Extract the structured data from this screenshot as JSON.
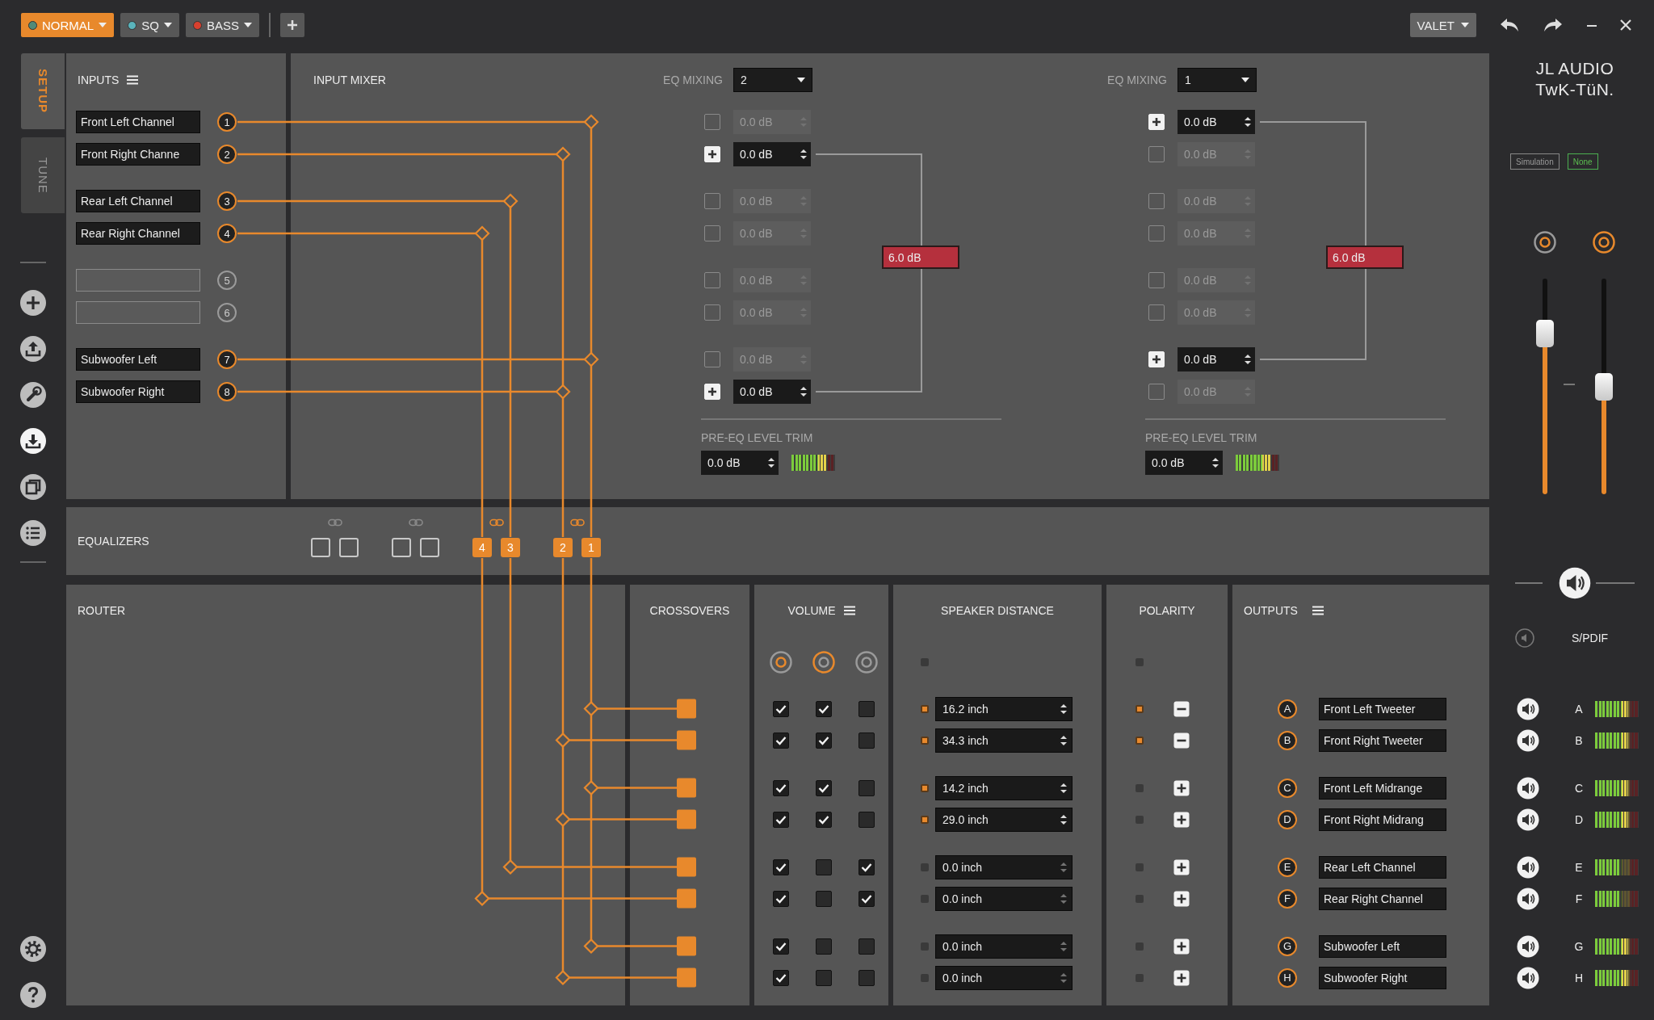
{
  "toolbar": {
    "presets": [
      {
        "label": "NORMAL",
        "selected": true,
        "color": "#4f8a78"
      },
      {
        "label": "SQ",
        "selected": false,
        "color": "#5ab4bc"
      },
      {
        "label": "BASS",
        "selected": false,
        "color": "#d8402e"
      }
    ],
    "mode_button": "VALET"
  },
  "side_tabs": [
    {
      "label": "SETUP",
      "selected": true
    },
    {
      "label": "TUNE",
      "selected": false
    }
  ],
  "inputs": {
    "title": "INPUTS",
    "items": [
      {
        "name": "Front Left Channel",
        "number": "1",
        "kind": "lane1"
      },
      {
        "name": "Front Right Channe",
        "number": "2",
        "kind": "lane2"
      },
      {
        "name": "Rear Left Channel",
        "number": "3",
        "kind": "lane3"
      },
      {
        "name": "Rear Right Channel",
        "number": "4",
        "kind": "lane4"
      },
      {
        "number": "5",
        "kind": "unrouted"
      },
      {
        "number": "6",
        "kind": "unrouted"
      },
      {
        "name": "Subwoofer Left",
        "number": "7",
        "kind": "lane1"
      },
      {
        "name": "Subwoofer Right",
        "number": "8",
        "kind": "lane2"
      }
    ]
  },
  "input_mixer": {
    "title": "INPUT MIXER",
    "groups": [
      {
        "label": "EQ MIXING",
        "value": "2",
        "rows": [
          {
            "checked": false,
            "value": "0.0 dB"
          },
          {
            "checked": true,
            "value": "0.0 dB"
          },
          {
            "checked": false,
            "value": "0.0 dB"
          },
          {
            "checked": false,
            "value": "0.0 dB"
          },
          {
            "checked": false,
            "value": "0.0 dB"
          },
          {
            "checked": false,
            "value": "0.0 dB"
          },
          {
            "checked": false,
            "value": "0.0 dB"
          },
          {
            "checked": true,
            "value": "0.0 dB"
          }
        ],
        "total": "6.0 dB",
        "trim_label": "PRE-EQ LEVEL TRIM",
        "trim_value": "0.0 dB",
        "trim_meter": {
          "level": 0.8
        }
      },
      {
        "label": "EQ MIXING",
        "value": "1",
        "rows": [
          {
            "checked": true,
            "value": "0.0 dB"
          },
          {
            "checked": false,
            "value": "0.0 dB"
          },
          {
            "checked": false,
            "value": "0.0 dB"
          },
          {
            "checked": false,
            "value": "0.0 dB"
          },
          {
            "checked": false,
            "value": "0.0 dB"
          },
          {
            "checked": false,
            "value": "0.0 dB"
          },
          {
            "checked": true,
            "value": "0.0 dB"
          },
          {
            "checked": false,
            "value": "0.0 dB"
          }
        ],
        "total": "6.0 dB",
        "trim_label": "PRE-EQ LEVEL TRIM",
        "trim_value": "0.0 dB",
        "trim_meter": {
          "level": 0.8
        }
      }
    ]
  },
  "equalizers": {
    "title": "EQUALIZERS",
    "slots": [
      {
        "assigned": false
      },
      {
        "assigned": false
      },
      {
        "assigned": false
      },
      {
        "assigned": false
      },
      {
        "label": "4",
        "assigned": true
      },
      {
        "label": "3",
        "assigned": true
      },
      {
        "label": "2",
        "assigned": true
      },
      {
        "label": "1",
        "assigned": true
      }
    ]
  },
  "router": {
    "title": "ROUTER"
  },
  "crossovers": {
    "title": "CROSSOVERS"
  },
  "volume": {
    "title": "VOLUME"
  },
  "speaker_distance": {
    "title": "SPEAKER DISTANCE"
  },
  "polarity": {
    "title": "POLARITY"
  },
  "outputs": {
    "title": "OUTPUTS",
    "items": [
      {
        "letter": "A",
        "name": "Front Left Tweeter",
        "kind": "lane1",
        "volume_checks": [
          {
            "checked": true
          },
          {
            "checked": true
          },
          {
            "checked": false
          }
        ],
        "distance": "16.2 inch",
        "delay_active": true,
        "inverted": true
      },
      {
        "letter": "B",
        "name": "Front Right Tweeter",
        "kind": "lane2",
        "volume_checks": [
          {
            "checked": true
          },
          {
            "checked": true
          },
          {
            "checked": false
          }
        ],
        "distance": "34.3 inch",
        "delay_active": true,
        "inverted": true
      },
      {
        "letter": "C",
        "name": "Front Left Midrange",
        "kind": "lane1",
        "volume_checks": [
          {
            "checked": true
          },
          {
            "checked": true
          },
          {
            "checked": false
          }
        ],
        "distance": "14.2 inch",
        "delay_active": true,
        "inverted": false
      },
      {
        "letter": "D",
        "name": "Front Right Midrang",
        "kind": "lane2",
        "volume_checks": [
          {
            "checked": true
          },
          {
            "checked": true
          },
          {
            "checked": false
          }
        ],
        "distance": "29.0 inch",
        "delay_active": true,
        "inverted": false
      },
      {
        "letter": "E",
        "name": "Rear Left Channel",
        "kind": "lane3",
        "volume_checks": [
          {
            "checked": true
          },
          {
            "checked": false
          },
          {
            "checked": true
          }
        ],
        "distance": "0.0 inch",
        "delay_active": false,
        "inverted": false
      },
      {
        "letter": "F",
        "name": "Rear Right Channel",
        "kind": "lane4",
        "volume_checks": [
          {
            "checked": true
          },
          {
            "checked": false
          },
          {
            "checked": true
          }
        ],
        "distance": "0.0 inch",
        "delay_active": false,
        "inverted": false
      },
      {
        "letter": "G",
        "name": "Subwoofer Left",
        "kind": "lane1",
        "volume_checks": [
          {
            "checked": true
          },
          {
            "checked": false
          },
          {
            "checked": false
          }
        ],
        "distance": "0.0 inch",
        "delay_active": false,
        "inverted": false
      },
      {
        "letter": "H",
        "name": "Subwoofer Right",
        "kind": "lane2",
        "volume_checks": [
          {
            "checked": true
          },
          {
            "checked": false
          },
          {
            "checked": false
          }
        ],
        "distance": "0.0 inch",
        "delay_active": false,
        "inverted": false
      }
    ]
  },
  "brand": {
    "line1": "JL AUDIO",
    "line2": "TwK-TüN."
  },
  "status": [
    {
      "label": "Simulation",
      "active": false
    },
    {
      "label": "None",
      "active": true
    }
  ],
  "sliders": [
    {
      "level": 0.78
    },
    {
      "level": 0.5
    }
  ],
  "spdif": {
    "label": "S/PDIF"
  },
  "channel_meters": [
    {
      "letter": "A",
      "level": 0.75
    },
    {
      "letter": "B",
      "level": 0.75
    },
    {
      "letter": "C",
      "level": 0.75
    },
    {
      "letter": "D",
      "level": 0.75
    },
    {
      "letter": "E",
      "level": 0.6
    },
    {
      "letter": "F",
      "level": 0.6
    },
    {
      "letter": "G",
      "level": 0.75
    },
    {
      "letter": "H",
      "level": 0.75
    }
  ]
}
